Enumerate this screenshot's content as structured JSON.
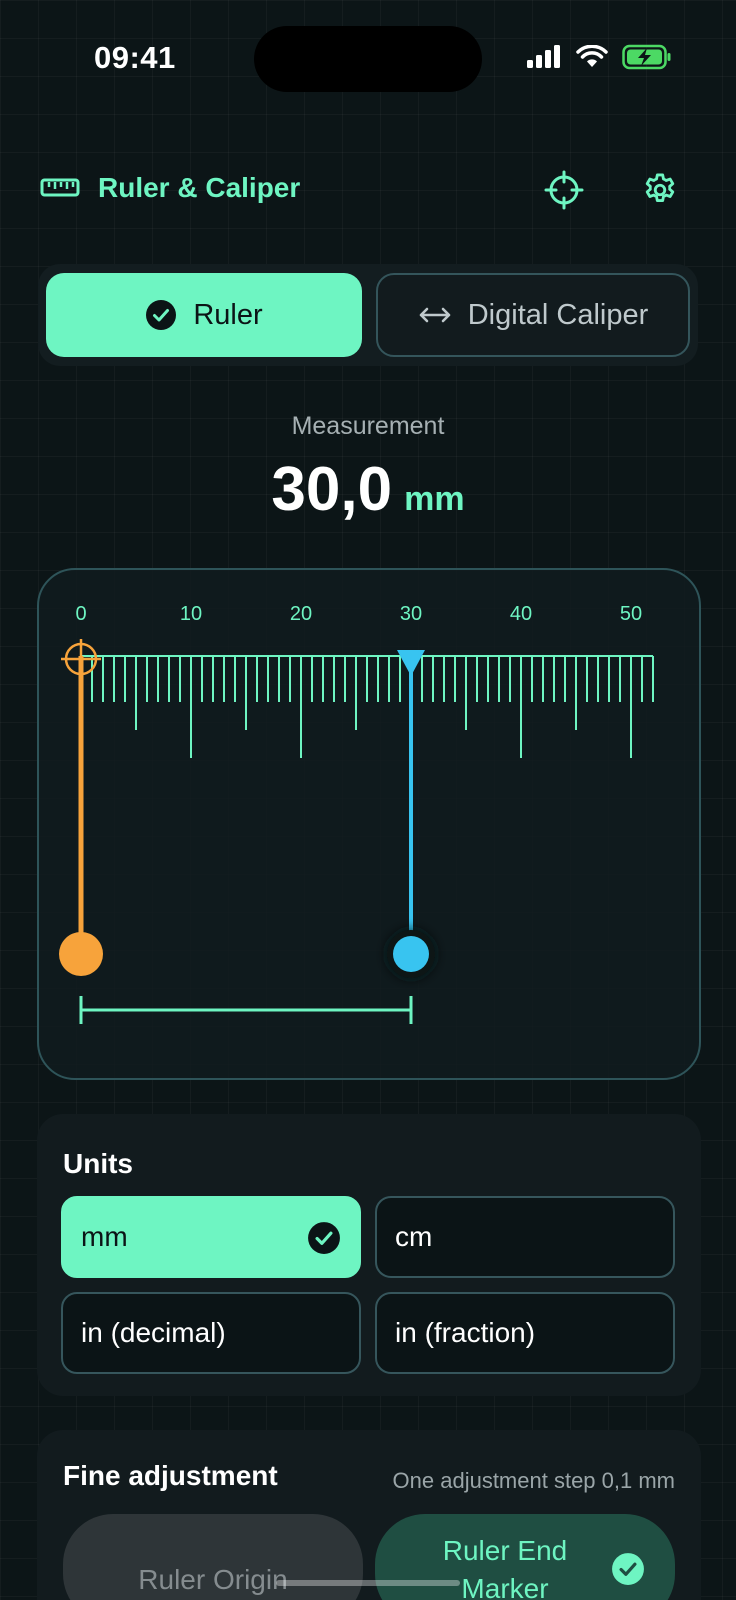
{
  "status_bar": {
    "time": "09:41"
  },
  "header": {
    "title": "Ruler & Caliper",
    "ruler_icon": "ruler-icon",
    "crosshair_icon": "crosshair-icon",
    "settings_icon": "gear-icon"
  },
  "mode_tabs": {
    "ruler_label": "Ruler",
    "caliper_label": "Digital Caliper",
    "selected": "Ruler"
  },
  "measurement": {
    "label": "Measurement",
    "value": "30,0",
    "unit": "mm"
  },
  "ruler": {
    "scale_labels": [
      "0",
      "10",
      "20",
      "30",
      "40",
      "50"
    ],
    "origin_value": 0,
    "end_value": 30,
    "max_value": 52,
    "colors": {
      "accent": "#6ef5c2",
      "origin": "#f7a33b",
      "end": "#38c4f0"
    }
  },
  "units": {
    "title": "Units",
    "options": [
      "mm",
      "cm",
      "in (decimal)",
      "in (fraction)"
    ],
    "selected": "mm"
  },
  "fine_adjustment": {
    "title": "Fine adjustment",
    "hint": "One adjustment step 0,1 mm",
    "origin_label": "Ruler Origin",
    "end_label_line1": "Ruler End",
    "end_label_line2": "Marker",
    "selected": "Ruler End Marker"
  }
}
